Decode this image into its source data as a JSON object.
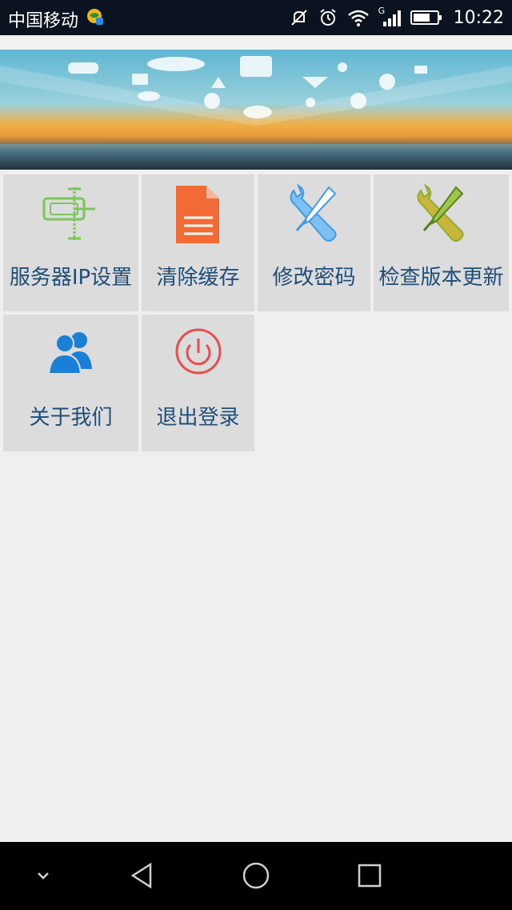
{
  "status_bar": {
    "carrier": "中国移动",
    "time": "10:22",
    "network_type": "G",
    "icons": [
      "mute-icon",
      "alarm-icon",
      "wifi-icon",
      "signal-icon",
      "battery-icon"
    ]
  },
  "banner": {
    "icons": [
      "stop-sign-icon",
      "traffic-light-icon",
      "cloud-icon",
      "phone-icon",
      "music-icon",
      "road-icon",
      "tire-icon",
      "speedometer-icon",
      "location-icon",
      "warning-icon"
    ]
  },
  "menu": {
    "items": [
      {
        "label": "服务器IP设置",
        "icon": "server-icon"
      },
      {
        "label": "清除缓存",
        "icon": "document-icon"
      },
      {
        "label": "修改密码",
        "icon": "tools-icon"
      },
      {
        "label": "检查版本更新",
        "icon": "tools-update-icon"
      },
      {
        "label": "关于我们",
        "icon": "users-icon"
      },
      {
        "label": "退出登录",
        "icon": "power-icon"
      }
    ]
  },
  "colors": {
    "label_text": "#1f4e79",
    "tile_background": "#dcdcdc",
    "page_background": "#efefef",
    "server_icon": "#7dc55b",
    "document_icon": "#f26a36",
    "tools_icon": "#3d9be9",
    "update_icon": "#8cb02d",
    "users_icon": "#1a7fd6",
    "power_icon": "#e84d4d"
  }
}
